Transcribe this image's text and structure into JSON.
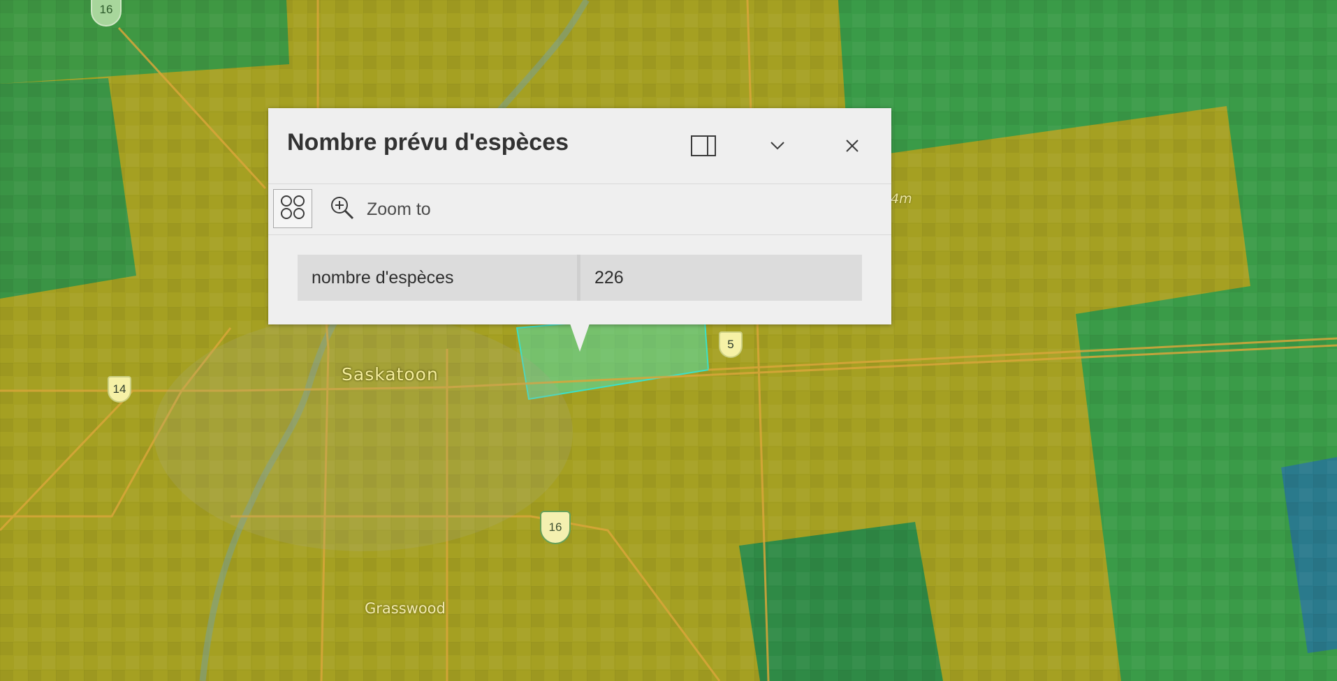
{
  "map": {
    "city_label": "Saskatoon",
    "place_label": "Grasswood",
    "scale_fragment": "4m",
    "route_shields": [
      "16",
      "14",
      "5",
      "16"
    ],
    "colors": {
      "base": "#9a9a2a",
      "low_density_overlay": "#3a9a46",
      "high_density_overlay": "#b6ae1c",
      "teal_overlay": "#1f7e8c",
      "selection_outline": "#3ce0c8",
      "roads": "#d9a63a"
    }
  },
  "popup": {
    "title": "Nombre prévu d'espèces",
    "icons": {
      "dock": "dock-side-icon",
      "collapse": "chevron-down-icon",
      "close": "close-icon",
      "actions": "grid-circles-icon",
      "zoom": "magnifier-plus-icon"
    },
    "actions": {
      "zoom_label": "Zoom to"
    },
    "attributes": [
      {
        "field": "nombre d'espèces",
        "value": "226"
      }
    ]
  }
}
